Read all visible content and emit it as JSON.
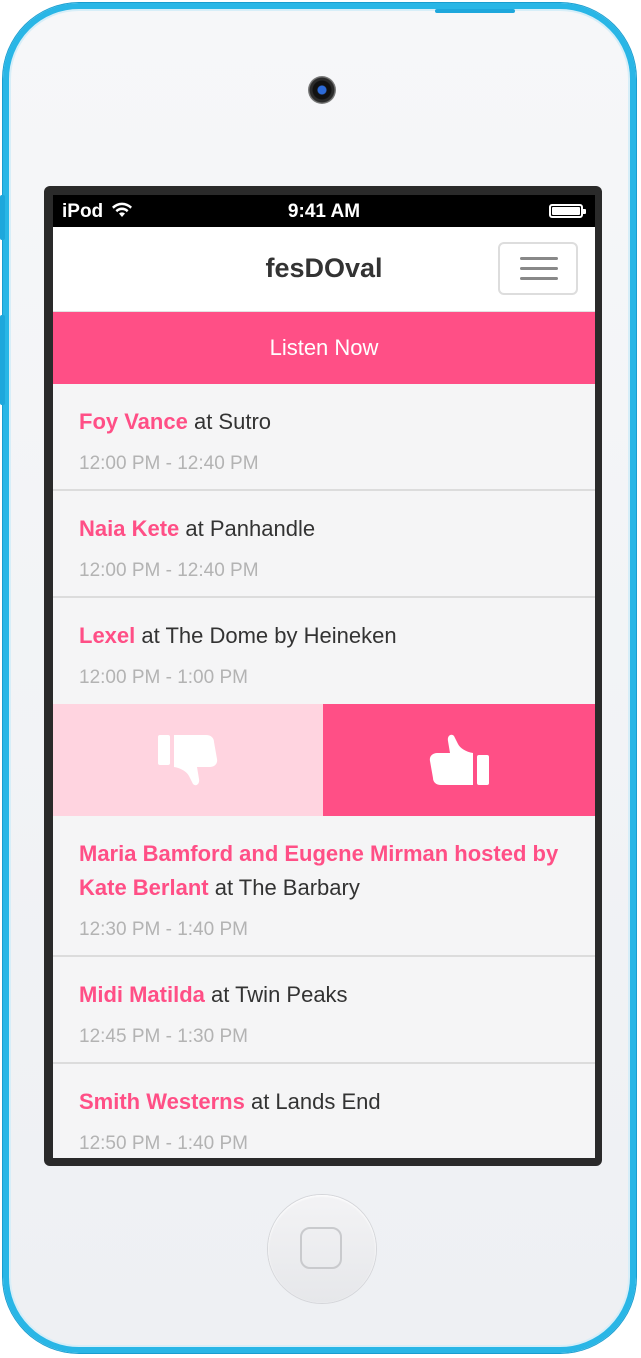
{
  "status_bar": {
    "carrier": "iPod",
    "time": "9:41 AM"
  },
  "header": {
    "title": "fesDOval",
    "menu_icon": "hamburger-icon"
  },
  "listen_button": {
    "label": "Listen Now"
  },
  "colors": {
    "accent": "#ff4f86",
    "accent_light": "#ffd4e0",
    "device_frame": "#29b6e6"
  },
  "schedule": [
    {
      "artist": "Foy Vance",
      "venue": " at Sutro",
      "time": "12:00 PM - 12:40 PM"
    },
    {
      "artist": "Naia Kete",
      "venue": " at Panhandle",
      "time": "12:00 PM - 12:40 PM"
    },
    {
      "artist": "Lexel",
      "venue": " at The Dome by Heineken",
      "time": "12:00 PM - 1:00 PM"
    },
    {
      "artist": "Maria Bamford and Eugene Mirman hosted by Kate Berlant",
      "venue": " at The Barbary",
      "time": "12:30 PM - 1:40 PM"
    },
    {
      "artist": "Midi Matilda",
      "venue": " at Twin Peaks",
      "time": "12:45 PM - 1:30 PM"
    },
    {
      "artist": "Smith Westerns",
      "venue": " at Lands End",
      "time": "12:50 PM - 1:40 PM"
    }
  ],
  "vote_actions": {
    "down_icon": "thumbs-down-icon",
    "up_icon": "thumbs-up-icon"
  }
}
